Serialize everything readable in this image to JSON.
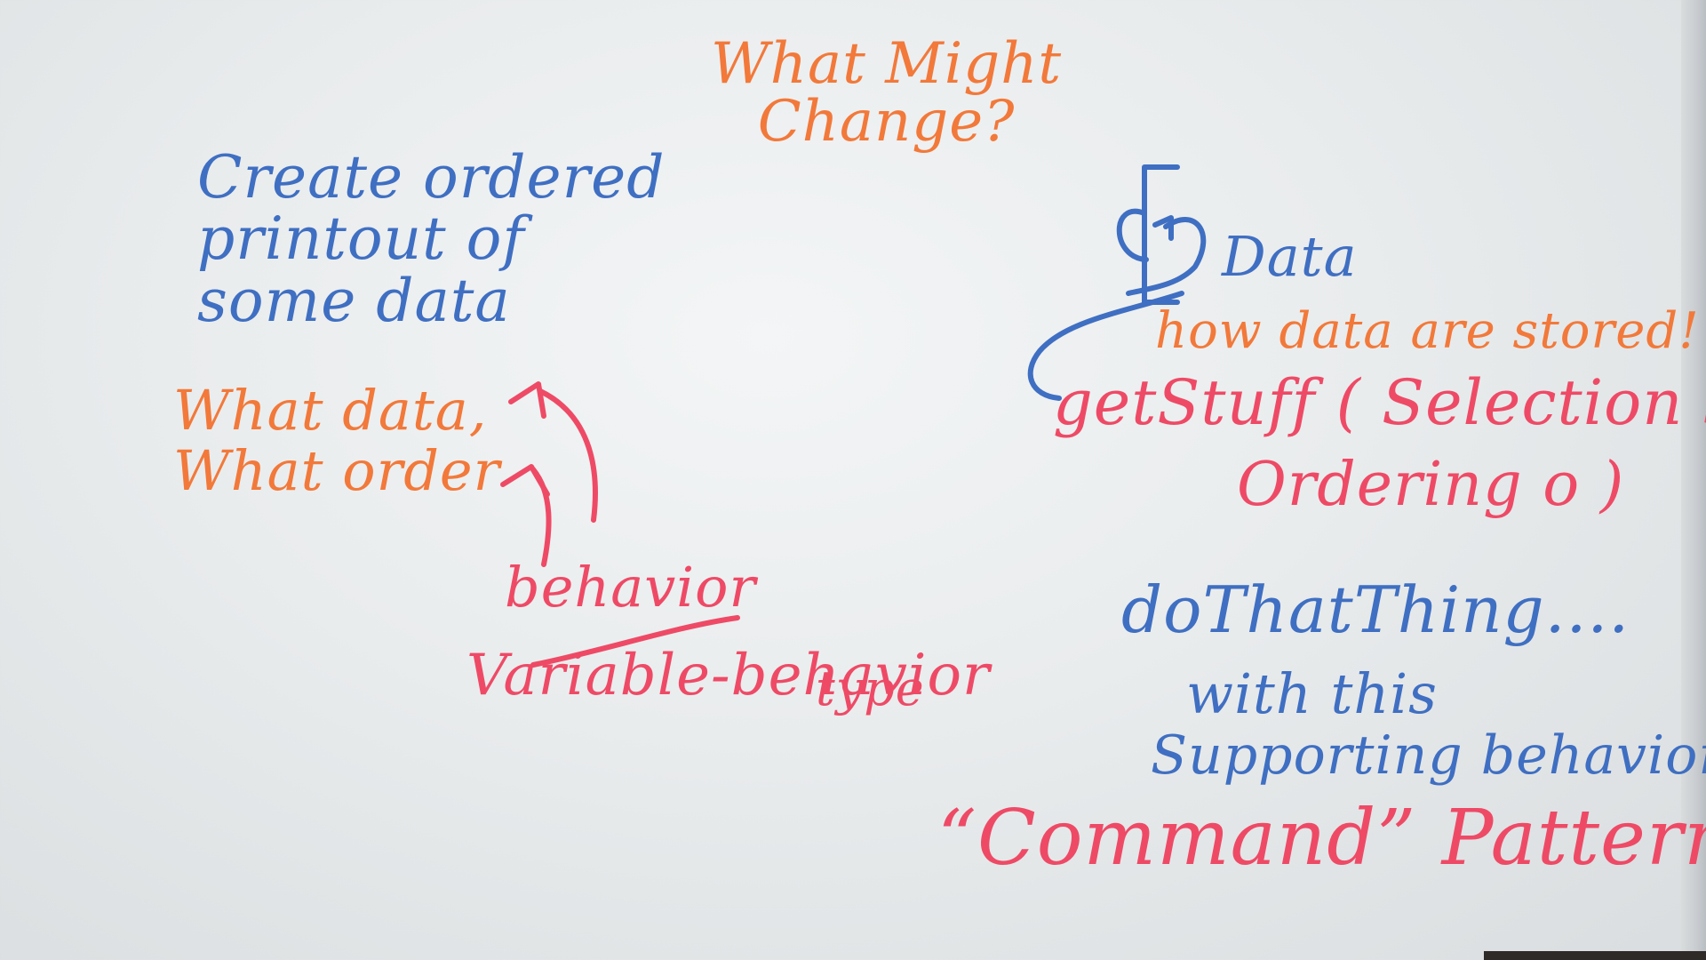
{
  "board": {
    "heading": [
      "What Might",
      "Change?"
    ],
    "left": {
      "create_lines": [
        "Create ordered",
        "printout of",
        "some data"
      ],
      "what_lines": [
        "What data,",
        "What order"
      ],
      "behavior": "behavior",
      "variable_behavior": "Variable-behavior",
      "type": "type"
    },
    "right": {
      "data": "Data",
      "how_stored": "how data are stored!",
      "get_stuff": "getStuff ( Selection s",
      "ordering": "Ordering o )",
      "do_that": "doThatThing....",
      "with_this": "with this",
      "supporting": "Supporting behavior",
      "command_pattern": "“Command” Pattern"
    }
  },
  "colors": {
    "blue_marker": "#3f6fc2",
    "orange_marker": "#f2793a",
    "pink_marker": "#ee4a66"
  }
}
